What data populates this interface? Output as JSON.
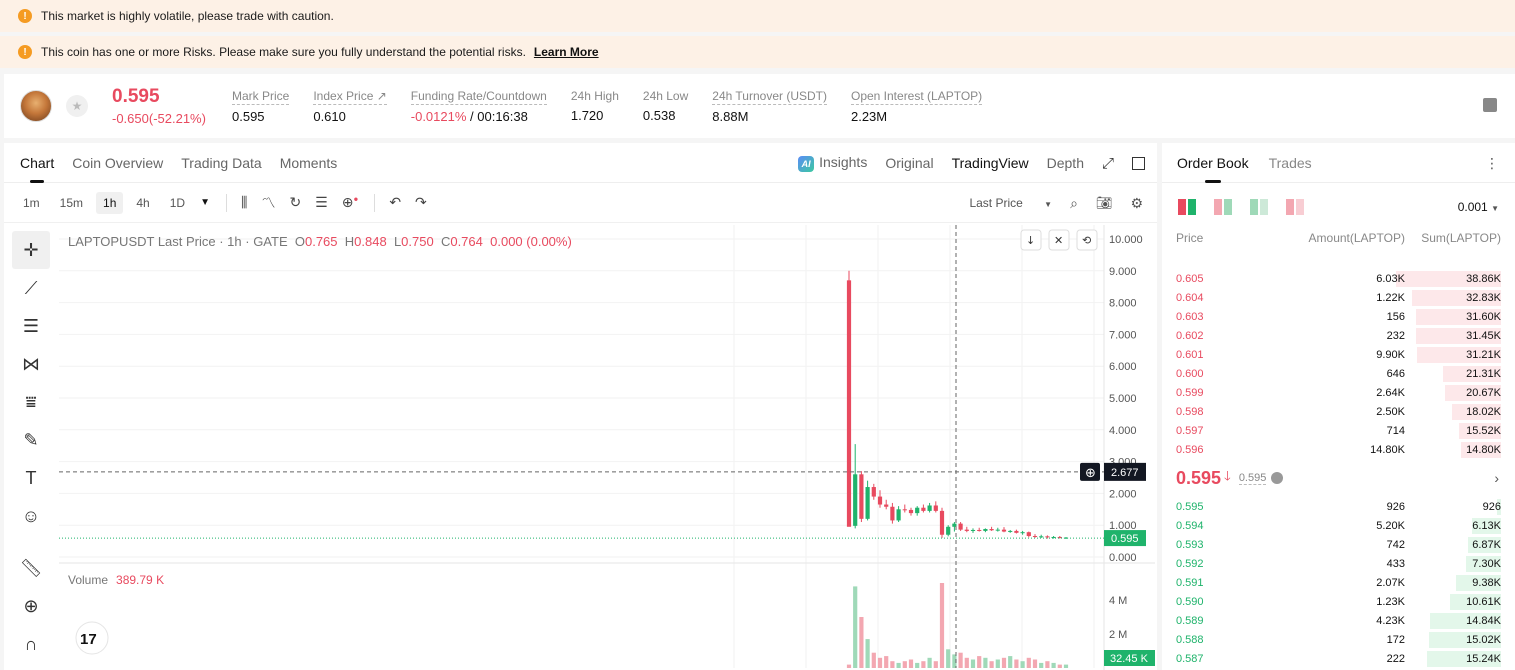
{
  "banners": {
    "volatile": "This market is highly volatile, please trade with caution.",
    "risk": "This coin has one or more Risks. Please make sure you fully understand the potential risks.",
    "learn_more": "Learn More"
  },
  "ticker": {
    "price": "0.595",
    "change": "-0.650(-52.21%)",
    "stats": [
      {
        "label": "Mark Price",
        "value": "0.595"
      },
      {
        "label": "Index Price ↗",
        "value": "0.610"
      },
      {
        "label": "Funding Rate/Countdown",
        "value_neg": "-0.0121%",
        "value": " / 00:16:38"
      },
      {
        "label": "24h High",
        "value": "1.720"
      },
      {
        "label": "24h Low",
        "value": "0.538"
      },
      {
        "label": "24h Turnover (USDT)",
        "value": "8.88M"
      },
      {
        "label": "Open Interest (LAPTOP)",
        "value": "2.23M"
      }
    ]
  },
  "chart_tabs": [
    "Chart",
    "Coin Overview",
    "Trading Data",
    "Moments"
  ],
  "chart_tabs_right": {
    "insights": "Insights",
    "original": "Original",
    "tradingview": "TradingView",
    "depth": "Depth"
  },
  "intervals": [
    "1m",
    "15m",
    "1h",
    "4h",
    "1D"
  ],
  "active_interval": "1h",
  "price_type": "Last Price",
  "legend": {
    "symbol": "LAPTOPUSDT Last Price · 1h · GATE",
    "o_label": "O",
    "o": "0.765",
    "h_label": "H",
    "h": "0.848",
    "l_label": "L",
    "l": "0.750",
    "c_label": "C",
    "c": "0.764",
    "chg": "0.000 (0.00%)"
  },
  "volume": {
    "label": "Volume",
    "value": "389.79 K",
    "last": "32.45 K"
  },
  "crosshair_price": "2.677",
  "last_price_tag": "0.595",
  "price_axis": [
    "10.000",
    "9.000",
    "8.000",
    "7.000",
    "6.000",
    "5.000",
    "4.000",
    "3.000",
    "2.000",
    "1.000",
    "0.000"
  ],
  "volume_axis": [
    "4 M",
    "2 M"
  ],
  "chart_data": {
    "type": "candlestick",
    "title": "",
    "candles": [
      {
        "o": 8.7,
        "h": 9.0,
        "l": 1.0,
        "c": 0.95,
        "dir": "down"
      },
      {
        "o": 0.98,
        "h": 3.55,
        "l": 0.9,
        "c": 2.6,
        "dir": "up"
      },
      {
        "o": 2.6,
        "h": 2.7,
        "l": 1.1,
        "c": 1.2,
        "dir": "down"
      },
      {
        "o": 1.2,
        "h": 2.4,
        "l": 1.15,
        "c": 2.2,
        "dir": "up"
      },
      {
        "o": 2.2,
        "h": 2.3,
        "l": 1.8,
        "c": 1.9,
        "dir": "down"
      },
      {
        "o": 1.9,
        "h": 2.1,
        "l": 1.55,
        "c": 1.65,
        "dir": "down"
      },
      {
        "o": 1.65,
        "h": 1.8,
        "l": 1.5,
        "c": 1.58,
        "dir": "down"
      },
      {
        "o": 1.58,
        "h": 1.7,
        "l": 1.05,
        "c": 1.15,
        "dir": "down"
      },
      {
        "o": 1.15,
        "h": 1.6,
        "l": 1.1,
        "c": 1.5,
        "dir": "up"
      },
      {
        "o": 1.5,
        "h": 1.65,
        "l": 1.4,
        "c": 1.48,
        "dir": "down"
      },
      {
        "o": 1.48,
        "h": 1.55,
        "l": 1.3,
        "c": 1.38,
        "dir": "down"
      },
      {
        "o": 1.38,
        "h": 1.6,
        "l": 1.3,
        "c": 1.55,
        "dir": "up"
      },
      {
        "o": 1.55,
        "h": 1.65,
        "l": 1.4,
        "c": 1.45,
        "dir": "down"
      },
      {
        "o": 1.45,
        "h": 1.7,
        "l": 1.4,
        "c": 1.62,
        "dir": "up"
      },
      {
        "o": 1.62,
        "h": 1.75,
        "l": 1.4,
        "c": 1.45,
        "dir": "down"
      },
      {
        "o": 1.45,
        "h": 1.55,
        "l": 0.6,
        "c": 0.7,
        "dir": "down"
      },
      {
        "o": 0.7,
        "h": 1.0,
        "l": 0.65,
        "c": 0.95,
        "dir": "up"
      },
      {
        "o": 0.95,
        "h": 1.1,
        "l": 0.8,
        "c": 1.05,
        "dir": "up"
      },
      {
        "o": 1.05,
        "h": 1.1,
        "l": 0.82,
        "c": 0.86,
        "dir": "down"
      },
      {
        "o": 0.86,
        "h": 0.95,
        "l": 0.78,
        "c": 0.82,
        "dir": "down"
      },
      {
        "o": 0.82,
        "h": 0.9,
        "l": 0.76,
        "c": 0.85,
        "dir": "up"
      },
      {
        "o": 0.85,
        "h": 0.92,
        "l": 0.8,
        "c": 0.82,
        "dir": "down"
      },
      {
        "o": 0.82,
        "h": 0.9,
        "l": 0.78,
        "c": 0.88,
        "dir": "up"
      },
      {
        "o": 0.88,
        "h": 0.95,
        "l": 0.82,
        "c": 0.84,
        "dir": "down"
      },
      {
        "o": 0.84,
        "h": 0.92,
        "l": 0.8,
        "c": 0.86,
        "dir": "up"
      },
      {
        "o": 0.86,
        "h": 0.94,
        "l": 0.78,
        "c": 0.8,
        "dir": "down"
      },
      {
        "o": 0.8,
        "h": 0.85,
        "l": 0.76,
        "c": 0.82,
        "dir": "up"
      },
      {
        "o": 0.82,
        "h": 0.86,
        "l": 0.74,
        "c": 0.76,
        "dir": "down"
      },
      {
        "o": 0.76,
        "h": 0.82,
        "l": 0.7,
        "c": 0.78,
        "dir": "up"
      },
      {
        "o": 0.78,
        "h": 0.8,
        "l": 0.62,
        "c": 0.66,
        "dir": "down"
      },
      {
        "o": 0.66,
        "h": 0.72,
        "l": 0.6,
        "c": 0.64,
        "dir": "down"
      },
      {
        "o": 0.64,
        "h": 0.7,
        "l": 0.6,
        "c": 0.65,
        "dir": "up"
      },
      {
        "o": 0.65,
        "h": 0.68,
        "l": 0.58,
        "c": 0.62,
        "dir": "down"
      },
      {
        "o": 0.62,
        "h": 0.66,
        "l": 0.58,
        "c": 0.63,
        "dir": "up"
      },
      {
        "o": 0.63,
        "h": 0.66,
        "l": 0.58,
        "c": 0.6,
        "dir": "down"
      },
      {
        "o": 0.6,
        "h": 0.63,
        "l": 0.57,
        "c": 0.61,
        "dir": "up"
      }
    ],
    "volumes_m": [
      0.2,
      4.8,
      3.0,
      1.7,
      0.9,
      0.6,
      0.7,
      0.4,
      0.3,
      0.4,
      0.5,
      0.3,
      0.4,
      0.6,
      0.4,
      5.0,
      1.1,
      0.8,
      0.9,
      0.6,
      0.5,
      0.7,
      0.6,
      0.4,
      0.5,
      0.6,
      0.7,
      0.5,
      0.4,
      0.6,
      0.5,
      0.3,
      0.4,
      0.3,
      0.2,
      0.2
    ],
    "ylim": [
      0,
      10
    ],
    "vol_ylim": [
      0,
      5
    ]
  },
  "order_book": {
    "tabs": [
      "Order Book",
      "Trades"
    ],
    "precision": "0.001",
    "headers": {
      "price": "Price",
      "amount": "Amount(LAPTOP)",
      "sum": "Sum(LAPTOP)"
    },
    "asks": [
      {
        "price": "0.605",
        "amount": "6.03K",
        "sum": "38.86K",
        "depth": 1.0
      },
      {
        "price": "0.604",
        "amount": "1.22K",
        "sum": "32.83K",
        "depth": 0.845
      },
      {
        "price": "0.603",
        "amount": "156",
        "sum": "31.60K",
        "depth": 0.813
      },
      {
        "price": "0.602",
        "amount": "232",
        "sum": "31.45K",
        "depth": 0.809
      },
      {
        "price": "0.601",
        "amount": "9.90K",
        "sum": "31.21K",
        "depth": 0.803
      },
      {
        "price": "0.600",
        "amount": "646",
        "sum": "21.31K",
        "depth": 0.548
      },
      {
        "price": "0.599",
        "amount": "2.64K",
        "sum": "20.67K",
        "depth": 0.532
      },
      {
        "price": "0.598",
        "amount": "2.50K",
        "sum": "18.02K",
        "depth": 0.464
      },
      {
        "price": "0.597",
        "amount": "714",
        "sum": "15.52K",
        "depth": 0.399
      },
      {
        "price": "0.596",
        "amount": "14.80K",
        "sum": "14.80K",
        "depth": 0.381
      }
    ],
    "mid_price": "0.595",
    "mark_price": "0.595",
    "bids": [
      {
        "price": "0.595",
        "amount": "926",
        "sum": "926",
        "depth": 0.04
      },
      {
        "price": "0.594",
        "amount": "5.20K",
        "sum": "6.13K",
        "depth": 0.28
      },
      {
        "price": "0.593",
        "amount": "742",
        "sum": "6.87K",
        "depth": 0.31
      },
      {
        "price": "0.592",
        "amount": "433",
        "sum": "7.30K",
        "depth": 0.33
      },
      {
        "price": "0.591",
        "amount": "2.07K",
        "sum": "9.38K",
        "depth": 0.43
      },
      {
        "price": "0.590",
        "amount": "1.23K",
        "sum": "10.61K",
        "depth": 0.49
      },
      {
        "price": "0.589",
        "amount": "4.23K",
        "sum": "14.84K",
        "depth": 0.68
      },
      {
        "price": "0.588",
        "amount": "172",
        "sum": "15.02K",
        "depth": 0.69
      },
      {
        "price": "0.587",
        "amount": "222",
        "sum": "15.24K",
        "depth": 0.7
      }
    ]
  },
  "colors": {
    "up": "#1fb36b",
    "down": "#e84a5f",
    "vol_up": "#9fd9b8",
    "vol_down": "#f3a7b1",
    "warn": "#f59b22"
  }
}
